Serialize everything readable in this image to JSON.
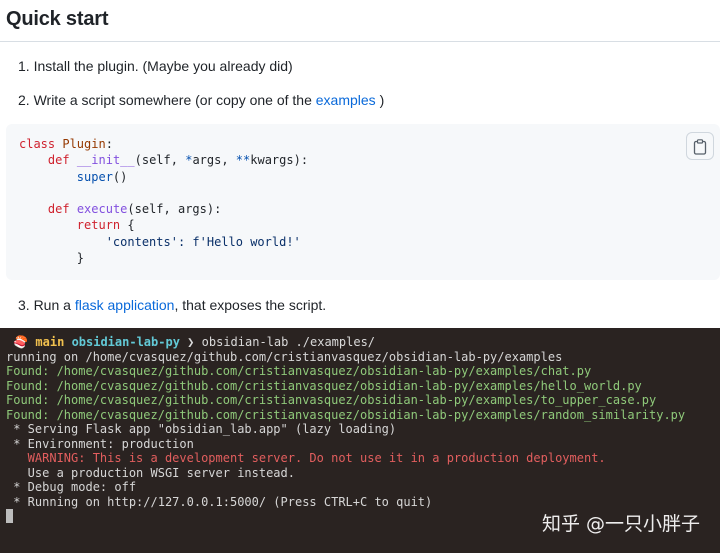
{
  "heading": "Quick start",
  "steps": {
    "s1": "1. Install the plugin. (Maybe you already did)",
    "s2_prefix": "2. Write a script somewhere (or copy one of the ",
    "s2_link": "examples",
    "s2_suffix": " )",
    "s3_prefix": "3. Run a ",
    "s3_link": "flask application",
    "s3_suffix": ", that exposes the script."
  },
  "code": {
    "kw_class": "class",
    "class_name": "Plugin",
    "class_colon": ":",
    "kw_def1": "def",
    "fn_init": "__init__",
    "init_args_a": "(self, ",
    "init_star": "*",
    "init_args_b": "args, ",
    "init_dstar": "**",
    "init_args_c": "kwargs):",
    "builtin_super": "super",
    "super_call": "()",
    "kw_def2": "def",
    "fn_execute": "execute",
    "execute_args": "(self, args):",
    "kw_return": "return",
    "return_brace": " {",
    "str_contents": "'contents'",
    "fstr": ": f'Hello world!'",
    "close_brace": "}"
  },
  "copy_icon": "clipboard-icon",
  "terminal": {
    "prompt_icon": "🍣",
    "branch": "main",
    "repo": "obsidian-lab-py",
    "chevron": "❯",
    "command": "obsidian-lab ./examples/",
    "lines": {
      "running": "running on /home/cvasquez/github.com/cristianvasquez/obsidian-lab-py/examples",
      "found1": "Found: /home/cvasquez/github.com/cristianvasquez/obsidian-lab-py/examples/chat.py",
      "found2": "Found: /home/cvasquez/github.com/cristianvasquez/obsidian-lab-py/examples/hello_world.py",
      "found3": "Found: /home/cvasquez/github.com/cristianvasquez/obsidian-lab-py/examples/to_upper_case.py",
      "found4": "Found: /home/cvasquez/github.com/cristianvasquez/obsidian-lab-py/examples/random_similarity.py",
      "serving": " * Serving Flask app \"obsidian_lab.app\" (lazy loading)",
      "env": " * Environment: production",
      "warning": "   WARNING: This is a development server. Do not use it in a production deployment.",
      "wsgi": "   Use a production WSGI server instead.",
      "debug": " * Debug mode: off",
      "running_on": " * Running on http://127.0.0.1:5000/ (Press CTRL+C to quit)"
    }
  },
  "watermark": "知乎 @一只小胖子"
}
